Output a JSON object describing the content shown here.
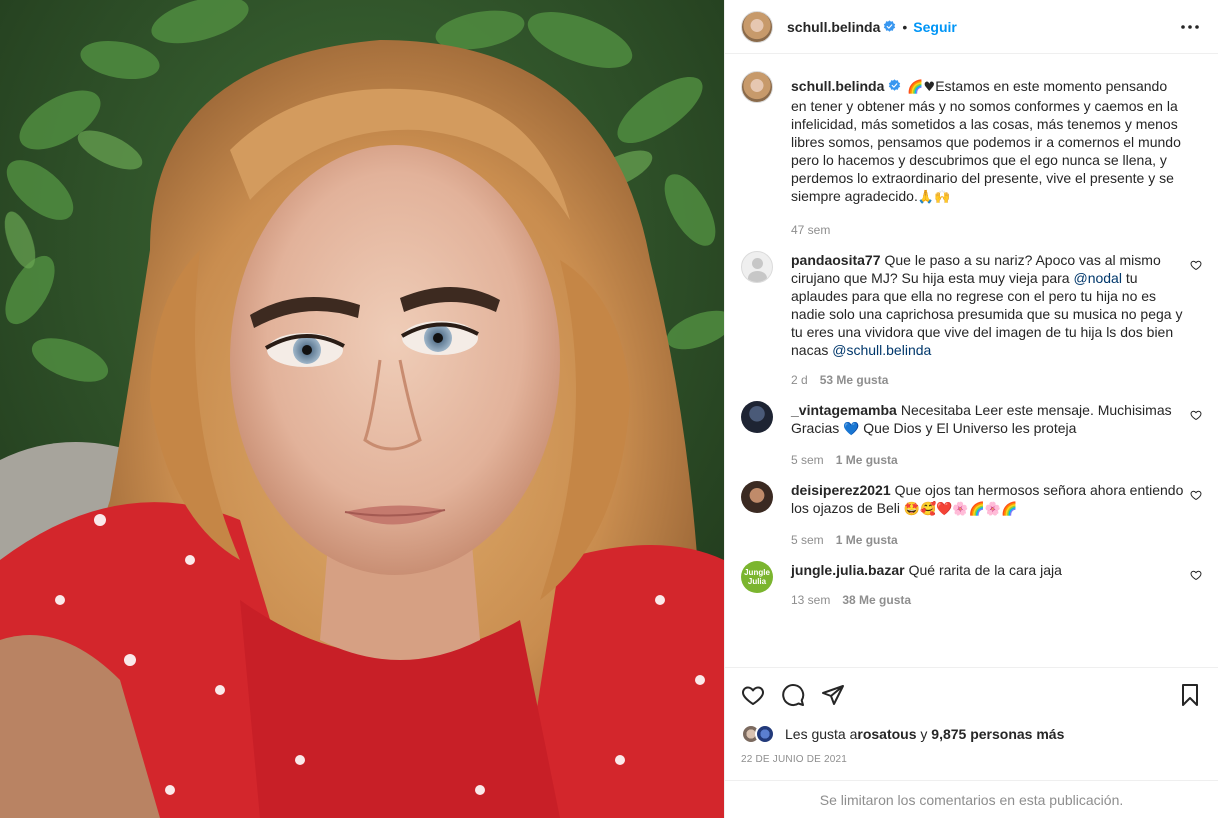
{
  "post": {
    "author": "schull.belinda",
    "follow_label": "Seguir",
    "dot": "•"
  },
  "caption": {
    "username": "schull.belinda",
    "emoji": "🌈♥",
    "text": "Estamos en este momento pensando en tener y obtener más y no somos conformes y caemos en la infelicidad, más sometidos a las cosas, más tenemos y menos libres somos, pensamos que podemos ir a comernos el mundo pero lo hacemos y descubrimos que el ego nunca se llena, y perdemos lo extraordinario del presente, vive el presente y se siempre agradecido.",
    "trailing_emoji": "🙏🙌",
    "time": "47 sem"
  },
  "comments": [
    {
      "username": "pandaosita77",
      "text_a": "Que le paso a su nariz? Apoco vas al mismo cirujano que MJ? Su hija esta muy vieja para ",
      "mention_a": "@nodal",
      "text_b": " tu aplaudes para que ella no regrese con el pero tu hija no es nadie solo una caprichosa presumida que su musica no pega y tu eres una vividora que vive del imagen de tu hija ls dos bien nacas ",
      "mention_b": "@schull.belinda",
      "time": "2 d",
      "likes": "53 Me gusta"
    },
    {
      "username": "_vintagemamba",
      "text": "Necesitaba Leer este mensaje. Muchisimas Gracias",
      "emoji": "💙",
      "text_after": " Que Dios y El Universo les proteja",
      "time": "5 sem",
      "likes": "1 Me gusta"
    },
    {
      "username": "deisiperez2021",
      "text": "Que ojos tan hermosos señora ahora entiendo los ojazos de Beli ",
      "emoji": "🤩🥰❤️🌸🌈🌸🌈",
      "time": "5 sem",
      "likes": "1 Me gusta"
    },
    {
      "username": "jungle.julia.bazar",
      "avatar_text": "Jungle Julia",
      "text": "Qué rarita de la cara jaja",
      "time": "13 sem",
      "likes": "38 Me gusta"
    }
  ],
  "likes": {
    "prefix": "Les gusta a ",
    "user": "rosatous",
    "middle": " y ",
    "count": "9,875 personas más"
  },
  "date": "22 DE JUNIO DE 2021",
  "comments_limited": "Se limitaron los comentarios en esta publicación.",
  "colors": {
    "accent": "#0095f6",
    "mention": "#00376b",
    "secondary_text": "#8e8e8e",
    "verified": "#3897f0"
  },
  "icons": [
    "more-icon",
    "verified-icon",
    "heart-icon",
    "comment-icon",
    "share-icon",
    "bookmark-icon"
  ]
}
